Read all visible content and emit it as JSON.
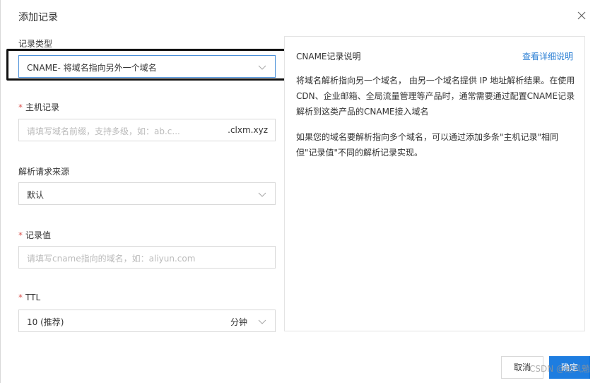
{
  "dialog": {
    "title": "添加记录"
  },
  "form": {
    "record_type": {
      "label": "记录类型",
      "value": "CNAME- 将域名指向另外一个域名"
    },
    "host": {
      "label": "主机记录",
      "placeholder": "请填写域名前缀，支持多级，如：ab.c...",
      "suffix": ".clxm.xyz"
    },
    "resolve_source": {
      "label": "解析请求来源",
      "value": "默认"
    },
    "record_value": {
      "label": "记录值",
      "placeholder": "请填写cname指向的域名，如：aliyun.com"
    },
    "ttl": {
      "label": "TTL",
      "value": "10 (推荐)",
      "unit": "分钟"
    },
    "required_mark": "*"
  },
  "info": {
    "title": "CNAME记录说明",
    "link": "查看详细说明",
    "paragraph1": "将域名解析指向另一个域名， 由另一个域名提供 IP 地址解析结果。在使用CDN、企业邮箱、全局流量管理等产品时，通常需要通过配置CNAME记录解析到这类产品的CNAME接入域名",
    "paragraph2": "如果您的域名要解析指向多个域名，可以通过添加多条\"主机记录\"相同但\"记录值\"不同的解析记录实现。"
  },
  "buttons": {
    "cancel": "取消",
    "ok": "确定"
  },
  "watermark": "CSDN @是风魈",
  "colors": {
    "primary": "#1e7de0",
    "link": "#2b7fd4",
    "required": "#d9534f"
  }
}
